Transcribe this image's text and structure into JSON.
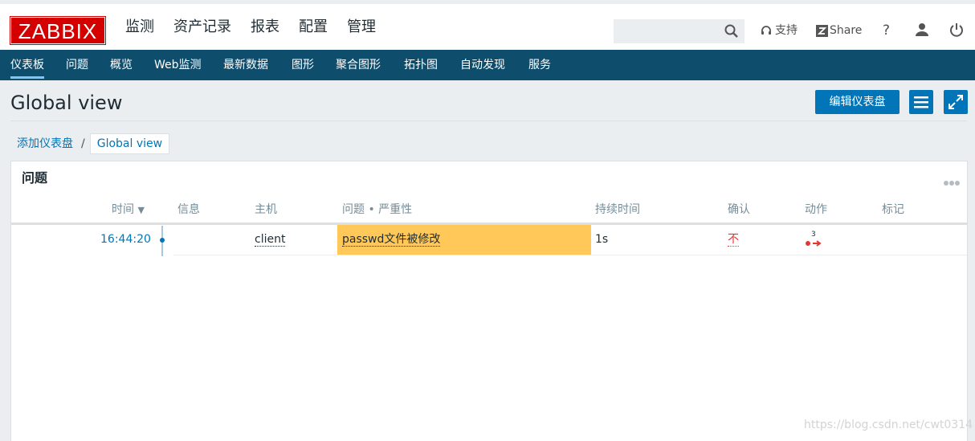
{
  "brand": {
    "logo_text": "ZABBIX",
    "logo_color": "#d40000"
  },
  "main_menu": [
    {
      "label": "监测",
      "active": true
    },
    {
      "label": "资产记录"
    },
    {
      "label": "报表"
    },
    {
      "label": "配置"
    },
    {
      "label": "管理"
    }
  ],
  "header": {
    "search_value": "",
    "search_icon": "search-icon",
    "support_label": "支持",
    "share_label": "Share",
    "help_label": "?",
    "user_icon": "user-icon",
    "logout_icon": "power-icon"
  },
  "sub_menu": [
    {
      "label": "仪表板",
      "active": true
    },
    {
      "label": "问题"
    },
    {
      "label": "概览"
    },
    {
      "label": "Web监测"
    },
    {
      "label": "最新数据"
    },
    {
      "label": "图形"
    },
    {
      "label": "聚合图形"
    },
    {
      "label": "拓扑图"
    },
    {
      "label": "自动发现"
    },
    {
      "label": "服务"
    }
  ],
  "page": {
    "title": "Global view",
    "edit_button": "编辑仪表盘",
    "menu_icon": "hamburger-icon",
    "fullscreen_icon": "fullscreen-icon"
  },
  "breadcrumb": {
    "parent": "添加仪表盘",
    "separator": "/",
    "current": "Global view"
  },
  "widget": {
    "title": "问题",
    "columns": [
      "时间",
      "信息",
      "主机",
      "问题 • 严重性",
      "持续时间",
      "确认",
      "动作",
      "标记"
    ],
    "sort_indicator": "▼",
    "rows": [
      {
        "time": "16:44:20",
        "info": "",
        "host": "client",
        "problem": "passwd文件被修改",
        "severity_color": "#ffc859",
        "duration": "1s",
        "ack": "不",
        "actions_count": "3",
        "tags": ""
      }
    ]
  },
  "watermark": "https://blog.csdn.net/cwt0314"
}
